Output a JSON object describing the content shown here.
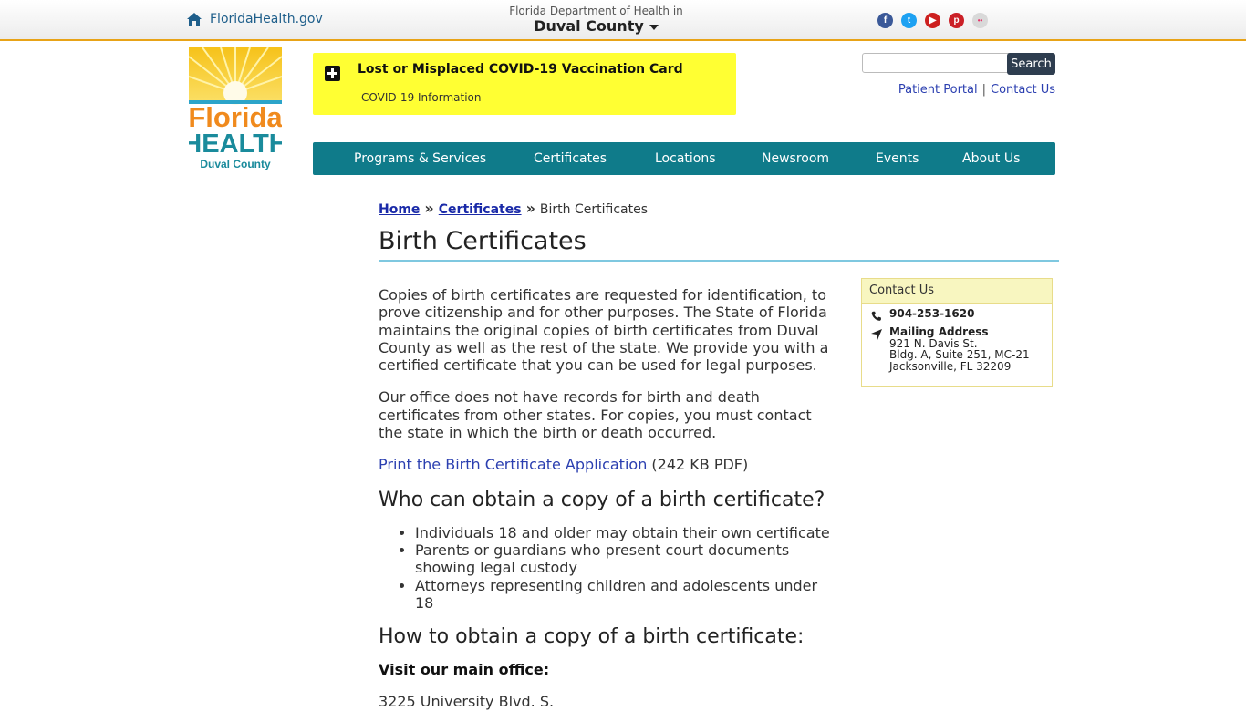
{
  "topbar": {
    "home_link": "FloridaHealth.gov",
    "dept_line1": "Florida Department of Health in",
    "dept_line2": "Duval County",
    "social": [
      {
        "name": "facebook-icon",
        "color": "#3b5998",
        "glyph": "f"
      },
      {
        "name": "twitter-icon",
        "color": "#1da1f2",
        "glyph": "t"
      },
      {
        "name": "youtube-icon",
        "color": "#cd201f",
        "glyph": "▶"
      },
      {
        "name": "pinterest-icon",
        "color": "#cb2027",
        "glyph": "p"
      },
      {
        "name": "flickr-icon",
        "color": "#d9d9d9",
        "glyph": "••"
      }
    ]
  },
  "logo": {
    "line1": "Florida",
    "line2": "HEALTH",
    "line3": "Duval County"
  },
  "alert": {
    "title": "Lost or Misplaced COVID-19 Vaccination Card",
    "subtitle": "COVID-19 Information",
    "background": "#ffff33"
  },
  "search": {
    "placeholder": "",
    "button": "Search"
  },
  "utility_links": {
    "patient_portal": "Patient Portal",
    "separator": "|",
    "contact_us": "Contact Us"
  },
  "nav": {
    "color": "#0f7b8a",
    "items": [
      "Programs & Services",
      "Certificates",
      "Locations",
      "Newsroom",
      "Events",
      "About Us"
    ]
  },
  "breadcrumb": {
    "home": "Home",
    "sep": "»",
    "certificates": "Certificates",
    "current": "Birth Certificates"
  },
  "page": {
    "title": "Birth Certificates",
    "para1": "Copies of birth certificates are requested for identification, to prove citizenship and for other purposes. The State of Florida maintains the original copies of birth certificates from Duval County as well as the rest of the state. We provide you with a certified certificate that you can be used for legal purposes.",
    "para2": "Our office does not have records for birth and death certificates from other states. For copies, you must contact the state in which the birth or death occurred.",
    "print_link": "Print the Birth Certificate Application",
    "print_meta": " (242 KB PDF)",
    "h2_who": "Who can obtain a copy of a birth certificate?",
    "who_list": [
      "Individuals 18 and older may obtain their own certificate",
      "Parents or guardians who present court documents showing legal custody",
      "Attorneys representing children and adolescents under 18"
    ],
    "h2_how": "How to obtain a copy of a birth certificate:",
    "visit_label": "Visit our main office:",
    "address_line": "3225 University Blvd. S."
  },
  "contact": {
    "heading": "Contact Us",
    "phone": "904-253-1620",
    "mailing_label": "Mailing Address",
    "addr1": "921 N. Davis St.",
    "addr2": "Bldg. A, Suite 251, MC-21",
    "addr3": "Jacksonville, FL 32209"
  }
}
